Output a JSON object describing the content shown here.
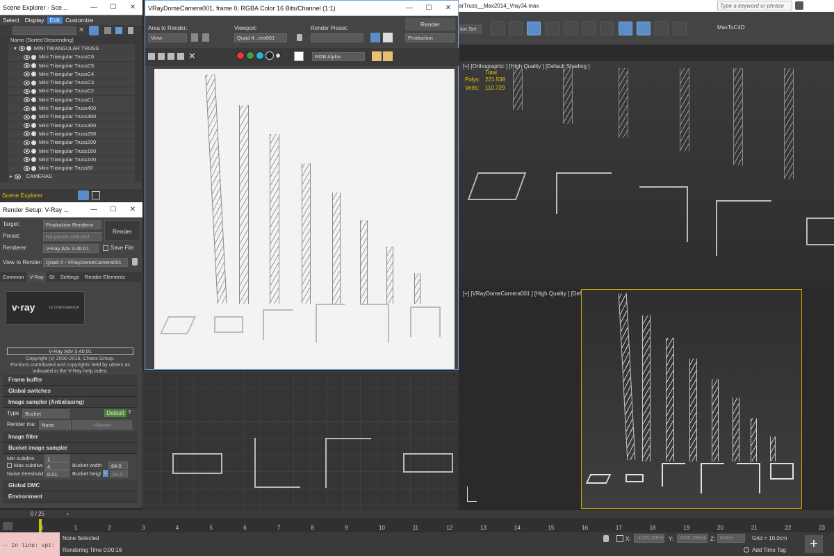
{
  "max_window": {
    "title": "arTruss__Max2014_Vray34.max",
    "search_placeholder": "Type a keyword or phrase",
    "selection_set_label": "ion Set",
    "plugin_label": "MaxToC4D"
  },
  "scene_explorer": {
    "title": "Scene Explorer - Sce...",
    "menu": [
      "Select",
      "Display",
      "Edit",
      "Customize"
    ],
    "column_header": "Name (Sorted Descending)",
    "root": "MINI TRIANGULAR TRUSS",
    "items": [
      "Mini Triangular TrussC6",
      "Mini Triangular TrussC5",
      "Mini Triangular TrussC4",
      "Mini Triangular TrussC3",
      "Mini Triangular TrussC2",
      "Mini Triangular TrussC1",
      "Mini Triangular Truss400",
      "Mini Triangular Truss350",
      "Mini Triangular Truss300",
      "Mini Triangular Truss250",
      "Mini Triangular Truss200",
      "Mini Triangular Truss150",
      "Mini Triangular Truss100",
      "Mini Triangular Truss50"
    ],
    "cameras": "CAMERAS",
    "footer_label": "Scene Explorer"
  },
  "render_setup": {
    "title": "Render Setup: V-Ray ...",
    "target_label": "Target:",
    "target_value": "Production Renderin",
    "preset_label": "Preset:",
    "preset_value": "No preset selected",
    "renderer_label": "Renderer:",
    "renderer_value": "V-Ray Adv 3.40.01",
    "save_file": "Save File",
    "view_label": "View to Render:",
    "view_value": "Quad 4 - VRayDomeCamera001",
    "render_button": "Render",
    "tabs": [
      "Common",
      "V-Ray",
      "GI",
      "Settings",
      "Render Elements"
    ],
    "logo_text": "v·ray",
    "logo_sub": "by CHAOSGROUP",
    "version_box": "V-Ray Adv 3.40.01",
    "copyright1": "Copyright (c) 2000-2016, Chaos Group.",
    "copyright2": "Portions contributed and copyrights held by others as",
    "copyright3": "indicated in the V-Ray help index.",
    "rollouts": {
      "frame_buffer": "Frame buffer",
      "global_switches": "Global switches",
      "image_sampler": "Image sampler (Antialiasing)",
      "image_filter": "Image filter",
      "bucket_sampler": "Bucket image sampler",
      "global_dmc": "Global DMC",
      "environment": "Environment"
    },
    "sampler": {
      "type_label": "Type",
      "type_value": "Bucket",
      "default_btn": "Default",
      "q_btn": "?",
      "render_mask_label": "Render ma:",
      "render_mask_value": "None",
      "none_value": "<None>"
    },
    "bucket": {
      "min_subdivs_label": "Min subdivs",
      "min_subdivs_value": "1",
      "max_subdivs_label": "Max subdivs",
      "max_subdivs_value": "4",
      "noise_label": "Noise threshold",
      "noise_value": "0.01",
      "bucket_width_label": "Bucket width",
      "bucket_width_value": "64.0",
      "bucket_height_label": "Bucket heigl",
      "bucket_height_value": "64.0",
      "lock_label": "L"
    }
  },
  "frame_buffer": {
    "title": "VRayDomeCamera001, frame 0, RGBA Color 16 Bits/Channel (1:1)",
    "area_label": "Area to Render:",
    "area_value": "View",
    "viewport_label": "Viewport:",
    "viewport_value": "Quad 4...era001",
    "preset_label": "Render Preset:",
    "preset_value": "",
    "render_button": "Render",
    "production_value": "Production",
    "channel_value": "RGB Alpha",
    "colors": {
      "red": "#e53935",
      "green": "#43a047",
      "blue": "#29b6d6",
      "bg": "#f3f3f3"
    }
  },
  "viewports": {
    "top_label": "[+] [Orthographic ] [High Quality ] [Default Shading ]",
    "stats_total": "Total",
    "polys_label": "Polys:",
    "polys_value": "221.538",
    "verts_label": "Verts:",
    "verts_value": "110.729",
    "cam_label": "[+] [VRayDomeCamera001 ] [High Quality ] [Default Shading ]"
  },
  "timeline": {
    "frame_counter": "0 / 25",
    "ticks": [
      "0",
      "1",
      "2",
      "3",
      "4",
      "5",
      "6",
      "7",
      "8",
      "9",
      "10",
      "11",
      "12",
      "13",
      "14",
      "15",
      "16",
      "17",
      "18",
      "19",
      "20",
      "21",
      "22",
      "23"
    ]
  },
  "status": {
    "script_line": "-- In line: vpt:",
    "selection": "None Selected",
    "render_time": "Rendering Time  0:00:16",
    "x_label": "X:",
    "x_value": "-1029,709cm",
    "y_label": "Y:",
    "y_value": "1335,296cm",
    "z_label": "Z:",
    "z_value": "0,0cm",
    "grid": "Grid = 10,0cm",
    "add_time_tag": "Add Time Tag"
  }
}
